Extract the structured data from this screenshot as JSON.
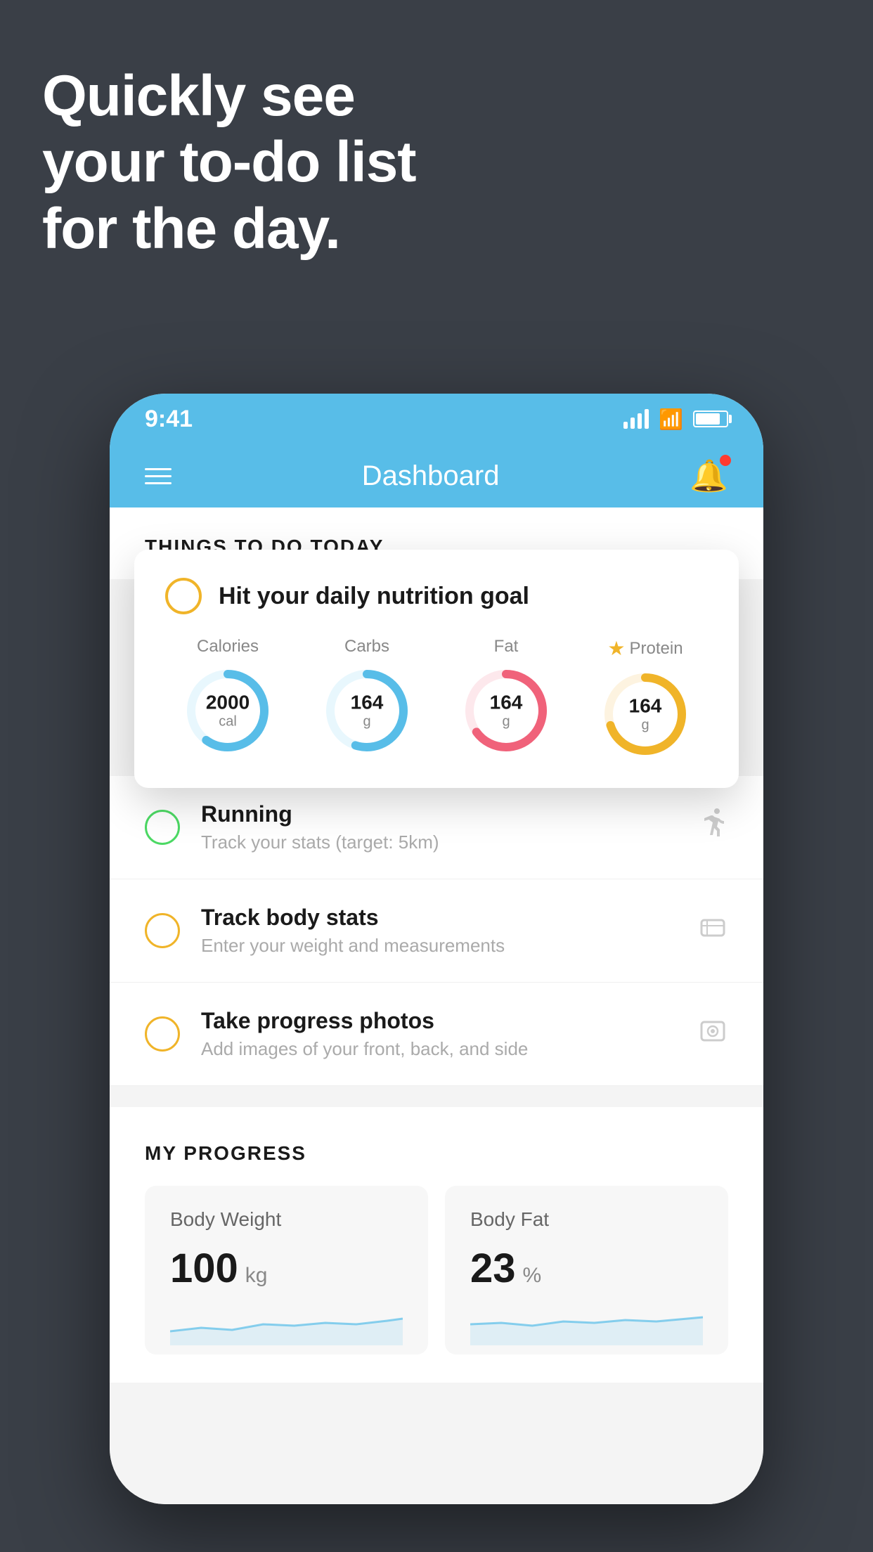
{
  "headline": {
    "line1": "Quickly see",
    "line2": "your to-do list",
    "line3": "for the day."
  },
  "statusBar": {
    "time": "9:41"
  },
  "navBar": {
    "title": "Dashboard"
  },
  "thingsToDoSection": {
    "header": "THINGS TO DO TODAY"
  },
  "nutritionCard": {
    "circleLabel": "",
    "title": "Hit your daily nutrition goal",
    "items": [
      {
        "label": "Calories",
        "value": "2000",
        "unit": "cal",
        "color": "#58bde8",
        "trackColor": "#e8f7fd",
        "progress": 0.6
      },
      {
        "label": "Carbs",
        "value": "164",
        "unit": "g",
        "color": "#58bde8",
        "trackColor": "#e8f7fd",
        "progress": 0.55
      },
      {
        "label": "Fat",
        "value": "164",
        "unit": "g",
        "color": "#f0627a",
        "trackColor": "#fde8ec",
        "progress": 0.65
      },
      {
        "label": "Protein",
        "value": "164",
        "unit": "g",
        "color": "#f0b429",
        "trackColor": "#fdf3e0",
        "progress": 0.7,
        "starred": true
      }
    ]
  },
  "todoItems": [
    {
      "id": "running",
      "title": "Running",
      "subtitle": "Track your stats (target: 5km)",
      "circleColor": "green",
      "icon": "👟"
    },
    {
      "id": "body-stats",
      "title": "Track body stats",
      "subtitle": "Enter your weight and measurements",
      "circleColor": "yellow",
      "icon": "⚖️"
    },
    {
      "id": "progress-photos",
      "title": "Take progress photos",
      "subtitle": "Add images of your front, back, and side",
      "circleColor": "yellow",
      "icon": "🖼️"
    }
  ],
  "progressSection": {
    "header": "MY PROGRESS",
    "cards": [
      {
        "title": "Body Weight",
        "value": "100",
        "unit": "kg"
      },
      {
        "title": "Body Fat",
        "value": "23",
        "unit": "%"
      }
    ]
  }
}
